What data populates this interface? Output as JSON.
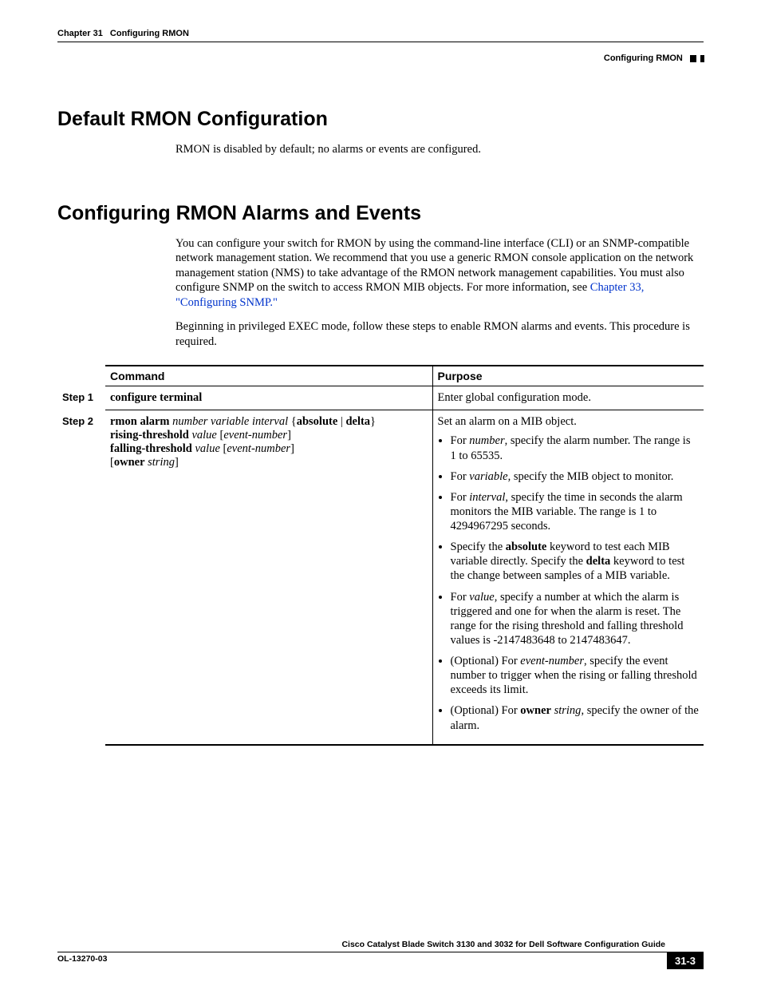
{
  "header": {
    "chapter_label": "Chapter 31",
    "chapter_title": "Configuring RMON",
    "section_right": "Configuring RMON"
  },
  "sections": {
    "s1": {
      "heading": "Default RMON Configuration",
      "body1": "RMON is disabled by default; no alarms or events are configured."
    },
    "s2": {
      "heading": "Configuring RMON Alarms and Events",
      "body1": "You can configure your switch for RMON by using the command-line interface (CLI) or an SNMP-compatible network management station. We recommend that you use a generic RMON console application on the network management station (NMS) to take advantage of the RMON network management capabilities. You must also configure SNMP on the switch to access RMON MIB objects. For more information, see ",
      "xref": "Chapter 33, \"Configuring SNMP.\"",
      "body2": "Beginning in privileged EXEC mode, follow these steps to enable RMON alarms and events. This procedure is required."
    }
  },
  "table": {
    "head_command": "Command",
    "head_purpose": "Purpose",
    "steps": {
      "step1": {
        "label": "Step 1",
        "command_bold": "configure terminal",
        "purpose_text": "Enter global configuration mode."
      },
      "step2": {
        "label": "Step 2",
        "cmd": {
          "t1": "rmon alarm",
          "t2": "number variable interval",
          "t3": "{",
          "t4": "absolute",
          "t5": " | ",
          "t6": "delta",
          "t7": "}",
          "t8": "rising-threshold",
          "t9": "value",
          "t10": "[",
          "t11": "event-number",
          "t12": "]",
          "t13": "falling-threshold",
          "t14": "value",
          "t15": "[",
          "t16": "event-number",
          "t17": "]",
          "t18": "[",
          "t19": "owner",
          "t20": "string",
          "t21": "]"
        },
        "purpose_intro": "Set an alarm on a MIB object.",
        "bullets": {
          "b1a": "For ",
          "b1b": "number",
          "b1c": ", specify the alarm number. The range is 1 to 65535.",
          "b2a": "For ",
          "b2b": "variable",
          "b2c": ", specify the MIB object to monitor.",
          "b3a": "For ",
          "b3b": "interval",
          "b3c": ", specify the time in seconds the alarm monitors the MIB variable. The range is 1 to 4294967295 seconds.",
          "b4a": "Specify the ",
          "b4b": "absolute",
          "b4c": " keyword to test each MIB variable directly. Specify the ",
          "b4d": "delta",
          "b4e": " keyword to test the change between samples of a MIB variable.",
          "b5a": "For ",
          "b5b": "value",
          "b5c": ", specify a number at which the alarm is triggered and one for when the alarm is reset. The range for the rising threshold and falling threshold values is -2147483648 to 2147483647.",
          "b6a": "(Optional) For ",
          "b6b": "event-number",
          "b6c": ", specify the event number to trigger when the rising or falling threshold exceeds its limit.",
          "b7a": "(Optional) For ",
          "b7b": "owner",
          "b7c": " ",
          "b7d": "string",
          "b7e": ", specify the owner of the alarm."
        }
      }
    }
  },
  "footer": {
    "guide_title": "Cisco Catalyst Blade Switch 3130 and 3032 for Dell Software Configuration Guide",
    "doc_id": "OL-13270-03",
    "page_number": "31-3"
  }
}
